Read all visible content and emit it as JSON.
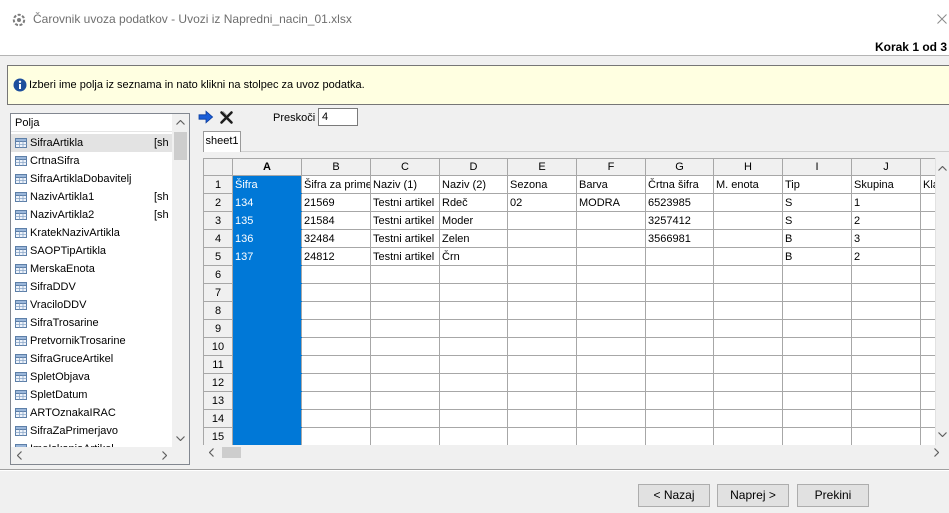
{
  "window": {
    "app_icon": "import-wizard-icon",
    "title": "Čarovnik uvoza podatkov - Uvozi iz Napredni_nacin_01.xlsx",
    "close_icon": "close-icon"
  },
  "wizard": {
    "step_label": "Korak 1 od 3"
  },
  "info": {
    "icon": "info-icon",
    "text": "Izberi ime polja iz seznama in nato klikni na stolpec za uvoz podatka."
  },
  "fields_panel": {
    "header": "Polja",
    "item_icon": "table-field-icon",
    "selected_index": 0,
    "items": [
      {
        "name": "SifraArtikla",
        "mapped": "[sh"
      },
      {
        "name": "CrtnaSifra"
      },
      {
        "name": "SifraArtiklaDobavitelj"
      },
      {
        "name": "NazivArtikla1",
        "mapped": "[sh"
      },
      {
        "name": "NazivArtikla2",
        "mapped": "[sh"
      },
      {
        "name": "KratekNazivArtikla"
      },
      {
        "name": "SAOPTipArtikla"
      },
      {
        "name": "MerskaEnota"
      },
      {
        "name": "SifraDDV"
      },
      {
        "name": "VraciloDDV"
      },
      {
        "name": "SifraTrosarine"
      },
      {
        "name": "PretvornikTrosarine"
      },
      {
        "name": "SifraGruceArtikel"
      },
      {
        "name": "SpletObjava"
      },
      {
        "name": "SpletDatum"
      },
      {
        "name": "ARTOznakaIRAC"
      },
      {
        "name": "SifraZaPrimerjavo"
      },
      {
        "name": "ImeIskanjaArtikel"
      }
    ]
  },
  "toolbar": {
    "assign_icon": "arrow-right-icon",
    "remove_icon": "remove-x-icon",
    "skip_label": "Preskoči",
    "skip_value": "4"
  },
  "sheet": {
    "tabs": [
      "sheet1"
    ],
    "active_tab": 0,
    "selected_column": "A",
    "columns": [
      "A",
      "B",
      "C",
      "D",
      "E",
      "F",
      "G",
      "H",
      "I",
      "J",
      ""
    ],
    "row_numbers": [
      "1",
      "2",
      "3",
      "4",
      "5",
      "6",
      "7",
      "8",
      "9",
      "10",
      "11",
      "12",
      "13",
      "14",
      "15"
    ],
    "rows": [
      [
        "Šifra",
        "Šifra za prime",
        "Naziv (1)",
        "Naziv (2)",
        "Sezona",
        "Barva",
        "Črtna šifra",
        "M. enota",
        "Tip",
        "Skupina",
        "Kla"
      ],
      [
        "134",
        "21569",
        "Testni artikel",
        "Rdeč",
        "02",
        "MODRA",
        "6523985",
        "",
        "S",
        "1",
        ""
      ],
      [
        "135",
        "21584",
        "Testni artikel",
        "Moder",
        "",
        "",
        "3257412",
        "",
        "S",
        "2",
        ""
      ],
      [
        "136",
        "32484",
        "Testni artikel",
        "Zelen",
        "",
        "",
        "3566981",
        "",
        "B",
        "3",
        ""
      ],
      [
        "137",
        "24812",
        "Testni artikel",
        "Črn",
        "",
        "",
        "",
        "",
        "B",
        "2",
        ""
      ]
    ]
  },
  "buttons": {
    "back": "< Nazaj",
    "next": "Naprej >",
    "cancel": "Prekini"
  },
  "colors": {
    "selected_column": "#0078d7",
    "info_background": "#ffffe1",
    "selected_field": "#e3e3e3"
  }
}
